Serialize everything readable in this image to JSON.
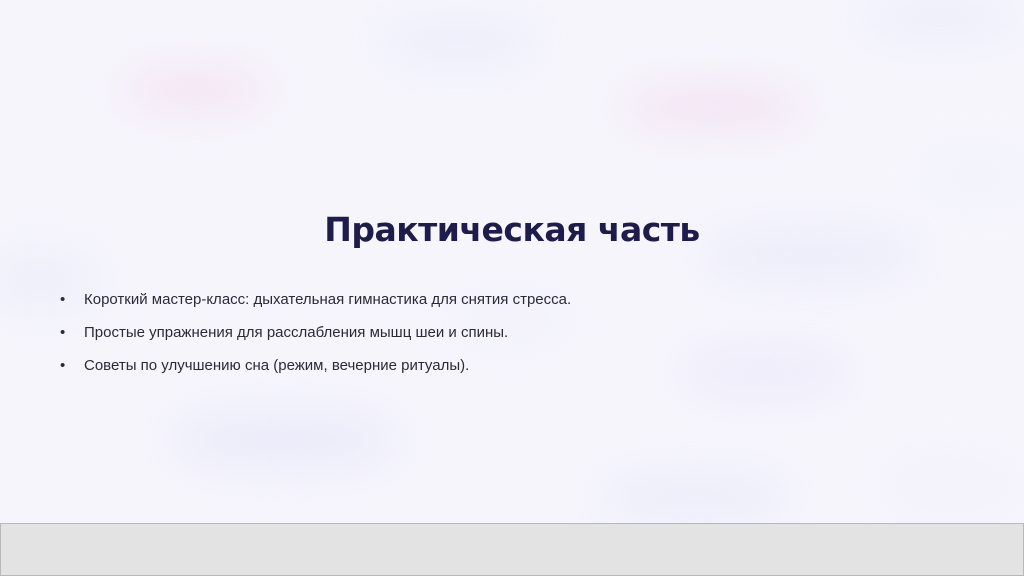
{
  "slide": {
    "title": "Практическая часть",
    "bullets": [
      {
        "marker": "•",
        "text": "Короткий мастер-класс: дыхательная гимнастика для снятия стресса."
      },
      {
        "marker": "•",
        "text": "Простые упражнения для расслабления мышц шеи и спины."
      },
      {
        "marker": "•",
        "text": "Советы по улучшению сна (режим, вечерние ритуалы)."
      }
    ]
  },
  "colors": {
    "background": "#f6f5fc",
    "title": "#1d1c4a",
    "body_text": "#2b2b37",
    "footer_bar": "#e3e3e3"
  }
}
